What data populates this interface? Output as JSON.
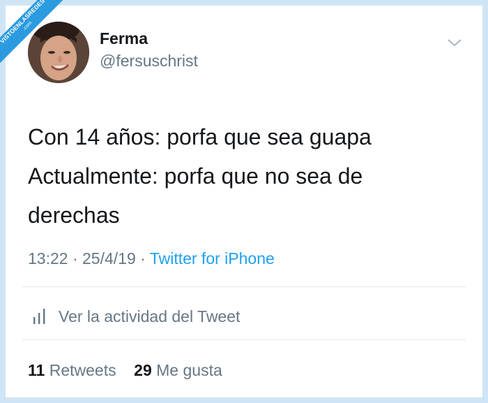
{
  "watermark": {
    "line1": "VISTOENLASREDES",
    "line2": ".com"
  },
  "user": {
    "name": "Ferma",
    "handle": "@fersuschrist"
  },
  "tweet": {
    "line1": "Con 14 años: porfa que sea guapa",
    "line2": "Actualmente: porfa que no sea de",
    "line3": "derechas"
  },
  "meta": {
    "time": "13:22",
    "sep1": "·",
    "date": "25/4/19",
    "sep2": "·",
    "source": "Twitter for iPhone"
  },
  "activity": {
    "label": "Ver la actividad del Tweet",
    "icon": "bar-chart-icon"
  },
  "stats": {
    "retweets_count": "11",
    "retweets_label": "Retweets",
    "likes_count": "29",
    "likes_label": "Me gusta"
  },
  "colors": {
    "background": "#cfe5f5",
    "card": "#ffffff",
    "text_primary": "#14171a",
    "text_secondary": "#657786",
    "link": "#1da1f2",
    "badge": "#2b9be0",
    "divider": "#e1e8ed"
  }
}
